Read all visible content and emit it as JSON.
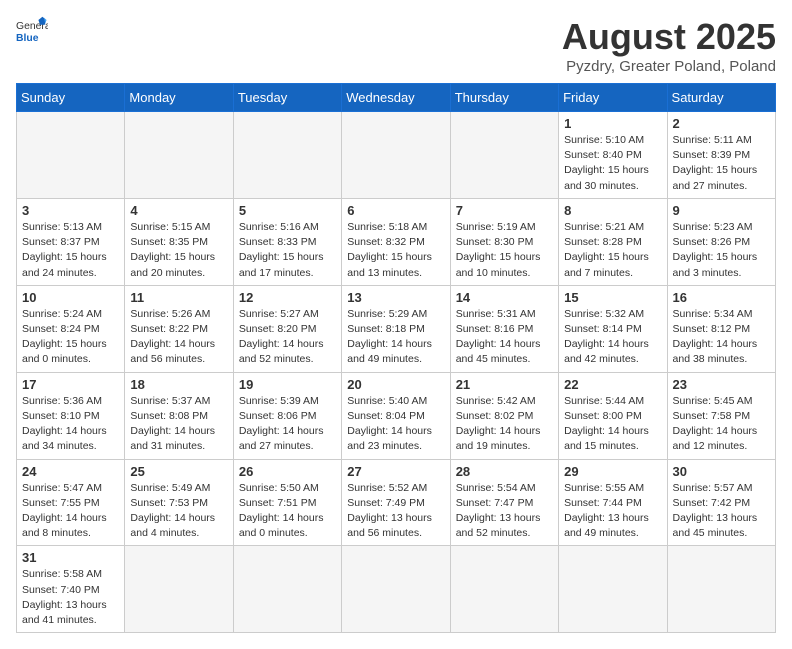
{
  "header": {
    "logo_text_normal": "General",
    "logo_text_bold": "Blue",
    "month_title": "August 2025",
    "subtitle": "Pyzdry, Greater Poland, Poland"
  },
  "weekdays": [
    "Sunday",
    "Monday",
    "Tuesday",
    "Wednesday",
    "Thursday",
    "Friday",
    "Saturday"
  ],
  "weeks": [
    [
      {
        "day": "",
        "info": "",
        "empty": true
      },
      {
        "day": "",
        "info": "",
        "empty": true
      },
      {
        "day": "",
        "info": "",
        "empty": true
      },
      {
        "day": "",
        "info": "",
        "empty": true
      },
      {
        "day": "",
        "info": "",
        "empty": true
      },
      {
        "day": "1",
        "info": "Sunrise: 5:10 AM\nSunset: 8:40 PM\nDaylight: 15 hours and 30 minutes."
      },
      {
        "day": "2",
        "info": "Sunrise: 5:11 AM\nSunset: 8:39 PM\nDaylight: 15 hours and 27 minutes."
      }
    ],
    [
      {
        "day": "3",
        "info": "Sunrise: 5:13 AM\nSunset: 8:37 PM\nDaylight: 15 hours and 24 minutes."
      },
      {
        "day": "4",
        "info": "Sunrise: 5:15 AM\nSunset: 8:35 PM\nDaylight: 15 hours and 20 minutes."
      },
      {
        "day": "5",
        "info": "Sunrise: 5:16 AM\nSunset: 8:33 PM\nDaylight: 15 hours and 17 minutes."
      },
      {
        "day": "6",
        "info": "Sunrise: 5:18 AM\nSunset: 8:32 PM\nDaylight: 15 hours and 13 minutes."
      },
      {
        "day": "7",
        "info": "Sunrise: 5:19 AM\nSunset: 8:30 PM\nDaylight: 15 hours and 10 minutes."
      },
      {
        "day": "8",
        "info": "Sunrise: 5:21 AM\nSunset: 8:28 PM\nDaylight: 15 hours and 7 minutes."
      },
      {
        "day": "9",
        "info": "Sunrise: 5:23 AM\nSunset: 8:26 PM\nDaylight: 15 hours and 3 minutes."
      }
    ],
    [
      {
        "day": "10",
        "info": "Sunrise: 5:24 AM\nSunset: 8:24 PM\nDaylight: 15 hours and 0 minutes."
      },
      {
        "day": "11",
        "info": "Sunrise: 5:26 AM\nSunset: 8:22 PM\nDaylight: 14 hours and 56 minutes."
      },
      {
        "day": "12",
        "info": "Sunrise: 5:27 AM\nSunset: 8:20 PM\nDaylight: 14 hours and 52 minutes."
      },
      {
        "day": "13",
        "info": "Sunrise: 5:29 AM\nSunset: 8:18 PM\nDaylight: 14 hours and 49 minutes."
      },
      {
        "day": "14",
        "info": "Sunrise: 5:31 AM\nSunset: 8:16 PM\nDaylight: 14 hours and 45 minutes."
      },
      {
        "day": "15",
        "info": "Sunrise: 5:32 AM\nSunset: 8:14 PM\nDaylight: 14 hours and 42 minutes."
      },
      {
        "day": "16",
        "info": "Sunrise: 5:34 AM\nSunset: 8:12 PM\nDaylight: 14 hours and 38 minutes."
      }
    ],
    [
      {
        "day": "17",
        "info": "Sunrise: 5:36 AM\nSunset: 8:10 PM\nDaylight: 14 hours and 34 minutes."
      },
      {
        "day": "18",
        "info": "Sunrise: 5:37 AM\nSunset: 8:08 PM\nDaylight: 14 hours and 31 minutes."
      },
      {
        "day": "19",
        "info": "Sunrise: 5:39 AM\nSunset: 8:06 PM\nDaylight: 14 hours and 27 minutes."
      },
      {
        "day": "20",
        "info": "Sunrise: 5:40 AM\nSunset: 8:04 PM\nDaylight: 14 hours and 23 minutes."
      },
      {
        "day": "21",
        "info": "Sunrise: 5:42 AM\nSunset: 8:02 PM\nDaylight: 14 hours and 19 minutes."
      },
      {
        "day": "22",
        "info": "Sunrise: 5:44 AM\nSunset: 8:00 PM\nDaylight: 14 hours and 15 minutes."
      },
      {
        "day": "23",
        "info": "Sunrise: 5:45 AM\nSunset: 7:58 PM\nDaylight: 14 hours and 12 minutes."
      }
    ],
    [
      {
        "day": "24",
        "info": "Sunrise: 5:47 AM\nSunset: 7:55 PM\nDaylight: 14 hours and 8 minutes."
      },
      {
        "day": "25",
        "info": "Sunrise: 5:49 AM\nSunset: 7:53 PM\nDaylight: 14 hours and 4 minutes."
      },
      {
        "day": "26",
        "info": "Sunrise: 5:50 AM\nSunset: 7:51 PM\nDaylight: 14 hours and 0 minutes."
      },
      {
        "day": "27",
        "info": "Sunrise: 5:52 AM\nSunset: 7:49 PM\nDaylight: 13 hours and 56 minutes."
      },
      {
        "day": "28",
        "info": "Sunrise: 5:54 AM\nSunset: 7:47 PM\nDaylight: 13 hours and 52 minutes."
      },
      {
        "day": "29",
        "info": "Sunrise: 5:55 AM\nSunset: 7:44 PM\nDaylight: 13 hours and 49 minutes."
      },
      {
        "day": "30",
        "info": "Sunrise: 5:57 AM\nSunset: 7:42 PM\nDaylight: 13 hours and 45 minutes."
      }
    ],
    [
      {
        "day": "31",
        "info": "Sunrise: 5:58 AM\nSunset: 7:40 PM\nDaylight: 13 hours and 41 minutes."
      },
      {
        "day": "",
        "info": "",
        "empty": true
      },
      {
        "day": "",
        "info": "",
        "empty": true
      },
      {
        "day": "",
        "info": "",
        "empty": true
      },
      {
        "day": "",
        "info": "",
        "empty": true
      },
      {
        "day": "",
        "info": "",
        "empty": true
      },
      {
        "day": "",
        "info": "",
        "empty": true
      }
    ]
  ]
}
